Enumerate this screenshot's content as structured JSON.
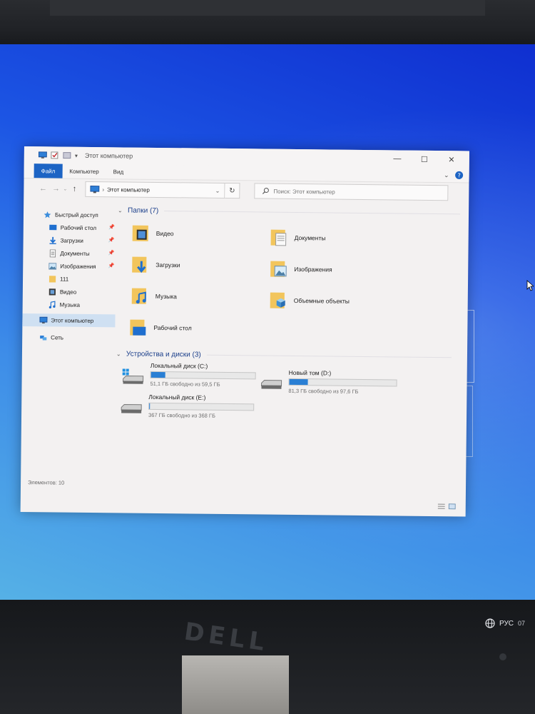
{
  "window": {
    "title": "Этот компьютер",
    "ribbon_tabs": [
      "Файл",
      "Компьютер",
      "Вид"
    ]
  },
  "address": {
    "path": "Этот компьютер",
    "search_placeholder": "Поиск: Этот компьютер"
  },
  "sidebar": {
    "items": [
      {
        "label": "Быстрый доступ",
        "icon": "star-icon",
        "pinned": false
      },
      {
        "label": "Рабочий стол",
        "icon": "desktop-icon",
        "pinned": true
      },
      {
        "label": "Загрузки",
        "icon": "download-icon",
        "pinned": true
      },
      {
        "label": "Документы",
        "icon": "document-icon",
        "pinned": true
      },
      {
        "label": "Изображения",
        "icon": "image-icon",
        "pinned": true
      },
      {
        "label": "111",
        "icon": "folder-icon",
        "pinned": false
      },
      {
        "label": "Видео",
        "icon": "video-icon",
        "pinned": false
      },
      {
        "label": "Музыка",
        "icon": "music-icon",
        "pinned": false
      },
      {
        "label": "Этот компьютер",
        "icon": "computer-icon",
        "pinned": false,
        "selected": true
      },
      {
        "label": "Сеть",
        "icon": "network-icon",
        "pinned": false
      }
    ]
  },
  "folders": {
    "header": "Папки (7)",
    "items": [
      {
        "label": "Видео",
        "icon": "video-folder-icon"
      },
      {
        "label": "Документы",
        "icon": "documents-folder-icon"
      },
      {
        "label": "Загрузки",
        "icon": "downloads-folder-icon"
      },
      {
        "label": "Изображения",
        "icon": "pictures-folder-icon"
      },
      {
        "label": "Музыка",
        "icon": "music-folder-icon"
      },
      {
        "label": "Объемные объекты",
        "icon": "3d-objects-folder-icon"
      },
      {
        "label": "Рабочий стол",
        "icon": "desktop-folder-icon"
      }
    ]
  },
  "drives": {
    "header": "Устройства и диски (3)",
    "items": [
      {
        "name": "Локальный диск (C:)",
        "info": "51,1 ГБ свободно из 59,5 ГБ",
        "used_fraction": 0.14,
        "icon": "windows-drive-icon"
      },
      {
        "name": "Новый том (D:)",
        "info": "81,3 ГБ свободно из 97,6 ГБ",
        "used_fraction": 0.17,
        "icon": "drive-icon"
      },
      {
        "name": "Локальный диск (E:)",
        "info": "367 ГБ свободно из 368 ГБ",
        "used_fraction": 0.003,
        "icon": "drive-icon"
      }
    ]
  },
  "status": {
    "items_count": "Элементов: 10"
  },
  "tray": {
    "language": "РУС",
    "clock": "07"
  },
  "colors": {
    "accent": "#1d64c4",
    "bar_fill": "#2a7fd4",
    "group_header": "#1a3e8a"
  }
}
